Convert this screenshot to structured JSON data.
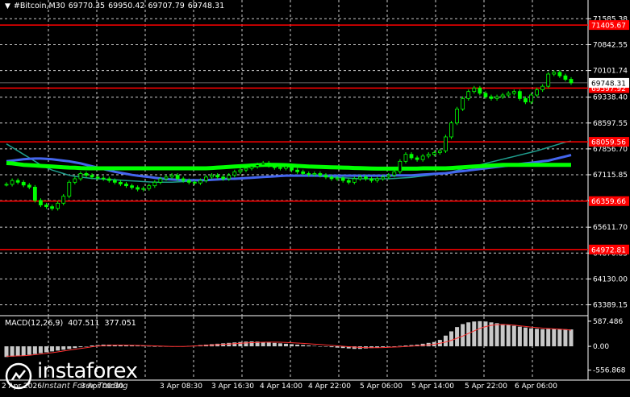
{
  "header": {
    "menu_icon": "triangle-down-icon",
    "symbol": "#Bitcoin,M30",
    "open": "69770.35",
    "high": "69950.42",
    "low": "69707.79",
    "close": "69748.31"
  },
  "macd": {
    "label": "MACD(12,26,9)",
    "value1": "407.511",
    "value2": "377.051"
  },
  "logo": {
    "name": "instaforex",
    "tagline": "Instant Forex Trading"
  },
  "colors": {
    "background": "#000000",
    "candle": "#00ff00",
    "level_line": "#ff0000",
    "ma_fast": "#1f9e8e",
    "ma_slow": "#4466ee",
    "ma_green": "#00ff00",
    "macd_hist": "#c8c8c8",
    "macd_signal": "#ff3030",
    "grid": "#ffffff"
  },
  "chart_data": {
    "type": "candlestick",
    "symbol": "#Bitcoin",
    "timeframe": "M30",
    "ylim": [
      63100,
      71800
    ],
    "price_ticks": [
      "71585.38",
      "70842.55",
      "70101.74",
      "69338.40",
      "68597.55",
      "67856.70",
      "67115.85",
      "66374.99",
      "65611.70",
      "64870.85",
      "64130.00",
      "63389.15"
    ],
    "price_ticks_values": [
      71585.38,
      70842.55,
      70101.74,
      69338.4,
      68597.55,
      67856.7,
      67115.85,
      66374.99,
      65611.7,
      64870.85,
      64130.0,
      63389.15
    ],
    "time_labels": [
      "2 Apr 2026",
      "3 Apr 00:30",
      "3 Apr 08:30",
      "3 Apr 16:30",
      "4 Apr 14:00",
      "4 Apr 22:00",
      "5 Apr 06:00",
      "5 Apr 14:00",
      "5 Apr 22:00",
      "6 Apr 06:00"
    ],
    "levels": [
      {
        "value": 71405.67,
        "label": "71405.67"
      },
      {
        "value": 69597.92,
        "label": "69597.92"
      },
      {
        "value": 68059.56,
        "label": "68059.56"
      },
      {
        "value": 66359.66,
        "label": "66359.66"
      },
      {
        "value": 64972.81,
        "label": "64972.81"
      }
    ],
    "current_price": {
      "value": 69748.31,
      "label": "69748.31"
    },
    "close_series": [
      66840,
      66950,
      66900,
      66820,
      66760,
      66380,
      66250,
      66200,
      66150,
      66300,
      66500,
      66900,
      67000,
      67150,
      67100,
      67050,
      67020,
      67000,
      66950,
      66900,
      66850,
      66800,
      66750,
      66700,
      66720,
      66800,
      66900,
      67000,
      67050,
      67100,
      67000,
      66950,
      66900,
      66880,
      66950,
      67050,
      67100,
      67050,
      67000,
      67100,
      67200,
      67250,
      67300,
      67350,
      67400,
      67450,
      67380,
      67320,
      67300,
      67350,
      67250,
      67200,
      67150,
      67120,
      67150,
      67100,
      67050,
      67000,
      67020,
      66950,
      66900,
      67000,
      67050,
      67000,
      66950,
      67000,
      67050,
      67100,
      67200,
      67500,
      67700,
      67600,
      67550,
      67650,
      67700,
      67750,
      67800,
      68200,
      68600,
      69000,
      69300,
      69500,
      69600,
      69450,
      69350,
      69300,
      69350,
      69400,
      69450,
      69500,
      69300,
      69200,
      69400,
      69550,
      69650,
      70000,
      70050,
      69950,
      69850,
      69750
    ],
    "ma_green_series": [
      67450,
      67440,
      67420,
      67400,
      67390,
      67380,
      67370,
      67360,
      67350,
      67340,
      67330,
      67320,
      67315,
      67305,
      67300,
      67300,
      67300,
      67300,
      67300,
      67300,
      67300,
      67300,
      67300,
      67300,
      67300,
      67300,
      67300,
      67300,
      67300,
      67300,
      67300,
      67300,
      67300,
      67300,
      67300,
      67300,
      67310,
      67320,
      67330,
      67340,
      67350,
      67360,
      67370,
      67380,
      67390,
      67400,
      67400,
      67400,
      67395,
      67390,
      67380,
      67370,
      67360,
      67350,
      67345,
      67340,
      67335,
      67330,
      67325,
      67320,
      67315,
      67310,
      67305,
      67300,
      67295,
      67290,
      67290,
      67290,
      67290,
      67290,
      67290,
      67290,
      67290,
      67300,
      67300,
      67300,
      67300,
      67300,
      67310,
      67320,
      67330,
      67340,
      67350,
      67360,
      67370,
      67380,
      67390,
      67400,
      67400,
      67400,
      67400,
      67400,
      67400,
      67400,
      67400,
      67400,
      67400,
      67400,
      67400,
      67400
    ],
    "ma_slow_series": [
      67500,
      67520,
      67540,
      67560,
      67570,
      67580,
      67580,
      67570,
      67560,
      67540,
      67520,
      67500,
      67470,
      67440,
      67400,
      67360,
      67320,
      67280,
      67240,
      67200,
      67170,
      67140,
      67110,
      67090,
      67070,
      67050,
      67030,
      67010,
      66990,
      66980,
      66970,
      66960,
      66960,
      66960,
      66960,
      66960,
      66970,
      66980,
      66990,
      67000,
      67000,
      67010,
      67020,
      67030,
      67040,
      67050,
      67060,
      67070,
      67080,
      67090,
      67090,
      67090,
      67090,
      67090,
      67090,
      67090,
      67090,
      67090,
      67090,
      67090,
      67090,
      67090,
      67090,
      67090,
      67090,
      67090,
      67090,
      67090,
      67100,
      67100,
      67100,
      67100,
      67110,
      67120,
      67130,
      67140,
      67150,
      67160,
      67180,
      67200,
      67220,
      67240,
      67260,
      67280,
      67300,
      67320,
      67340,
      67360,
      67380,
      67400,
      67420,
      67440,
      67460,
      67480,
      67500,
      67520,
      67560,
      67600,
      67640,
      67680
    ],
    "ma_fast_series": [
      68000,
      67900,
      67800,
      67700,
      67600,
      67500,
      67400,
      67320,
      67250,
      67200,
      67150,
      67100,
      67070,
      67050,
      67030,
      67010,
      67000,
      66990,
      66980,
      66970,
      66960,
      66950,
      66940,
      66930,
      66920,
      66910,
      66900,
      66900,
      66900,
      66900,
      66910,
      66920,
      66930,
      66940,
      66950,
      66960,
      66970,
      66980,
      66990,
      67000,
      67010,
      67020,
      67030,
      67040,
      67050,
      67060,
      67070,
      67080,
      67080,
      67080,
      67080,
      67080,
      67080,
      67080,
      67080,
      67070,
      67060,
      67050,
      67040,
      67030,
      67020,
      67010,
      67000,
      67000,
      67000,
      67000,
      67000,
      67000,
      67010,
      67020,
      67030,
      67040,
      67060,
      67080,
      67100,
      67120,
      67140,
      67160,
      67200,
      67240,
      67280,
      67320,
      67360,
      67400,
      67440,
      67480,
      67520,
      67560,
      67600,
      67640,
      67680,
      67720,
      67760,
      67800,
      67850,
      67900,
      67950,
      68000,
      68050,
      68080
    ],
    "macd": {
      "ticks": [
        "587.486",
        "0.00",
        "-556.868"
      ],
      "ticks_values": [
        587.486,
        0,
        -556.868
      ],
      "ylim": [
        -620,
        660
      ],
      "histogram": [
        -250,
        -240,
        -230,
        -220,
        -200,
        -180,
        -160,
        -140,
        -120,
        -100,
        -80,
        -60,
        -40,
        -20,
        0,
        20,
        30,
        40,
        40,
        35,
        30,
        25,
        20,
        15,
        10,
        5,
        0,
        -5,
        -10,
        -10,
        -5,
        0,
        10,
        20,
        30,
        40,
        50,
        60,
        70,
        80,
        90,
        100,
        110,
        115,
        110,
        100,
        90,
        80,
        70,
        60,
        50,
        40,
        30,
        20,
        10,
        0,
        -10,
        -20,
        -30,
        -40,
        -50,
        -60,
        -60,
        -50,
        -40,
        -30,
        -20,
        -10,
        0,
        10,
        20,
        30,
        40,
        60,
        80,
        100,
        150,
        250,
        350,
        450,
        520,
        560,
        580,
        587,
        580,
        560,
        540,
        520,
        500,
        480,
        460,
        440,
        420,
        410,
        400,
        405,
        410,
        407,
        400,
        395
      ],
      "signal": [
        -230,
        -230,
        -225,
        -220,
        -210,
        -195,
        -180,
        -165,
        -150,
        -130,
        -110,
        -90,
        -70,
        -50,
        -30,
        -10,
        5,
        15,
        25,
        30,
        30,
        28,
        25,
        22,
        18,
        14,
        10,
        6,
        2,
        -2,
        -3,
        -2,
        2,
        8,
        15,
        22,
        30,
        38,
        46,
        54,
        62,
        70,
        78,
        86,
        92,
        96,
        98,
        98,
        95,
        90,
        84,
        77,
        69,
        60,
        51,
        42,
        32,
        22,
        12,
        2,
        -8,
        -18,
        -26,
        -30,
        -32,
        -31,
        -28,
        -24,
        -18,
        -12,
        -5,
        3,
        12,
        22,
        34,
        48,
        70,
        100,
        140,
        190,
        240,
        300,
        360,
        420,
        460,
        490,
        505,
        510,
        505,
        495,
        480,
        465,
        450,
        438,
        425,
        415,
        408,
        402,
        390,
        377
      ]
    }
  }
}
